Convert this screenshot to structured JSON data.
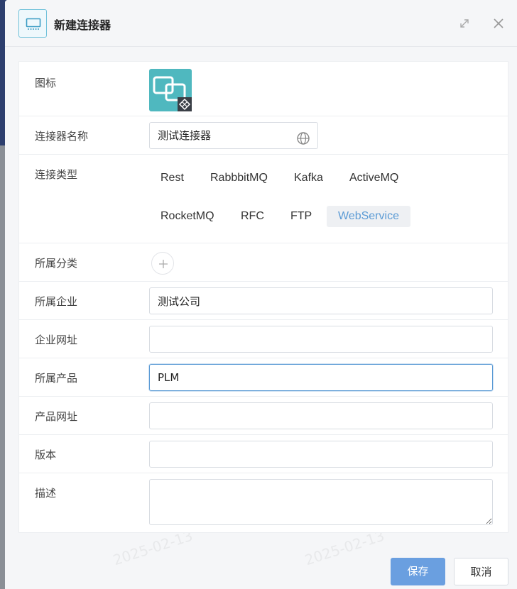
{
  "dialog": {
    "title": "新建连接器",
    "icon": "monitor-icon",
    "actions": {
      "expand_icon": "expand-icon",
      "close_icon": "close-icon"
    }
  },
  "form": {
    "icon_label": "图标",
    "name_label": "连接器名称",
    "name_value": "测试连接器",
    "type_label": "连接类型",
    "types": [
      "Rest",
      "RabbbitMQ",
      "Kafka",
      "ActiveMQ",
      "RocketMQ",
      "RFC",
      "FTP",
      "WebService"
    ],
    "selected_type": "WebService",
    "category_label": "所属分类",
    "company_label": "所属企业",
    "company_value": "测试公司",
    "company_url_label": "企业网址",
    "company_url_value": "",
    "product_label": "所属产品",
    "product_value": "PLM",
    "product_url_label": "产品网址",
    "product_url_value": "",
    "version_label": "版本",
    "version_value": "",
    "description_label": "描述",
    "description_value": ""
  },
  "footer": {
    "save_label": "保存",
    "cancel_label": "取消"
  },
  "colors": {
    "accent": "#6a9fe0",
    "icon_tile": "#4fb8bf",
    "selected_text": "#5b9bd5"
  }
}
